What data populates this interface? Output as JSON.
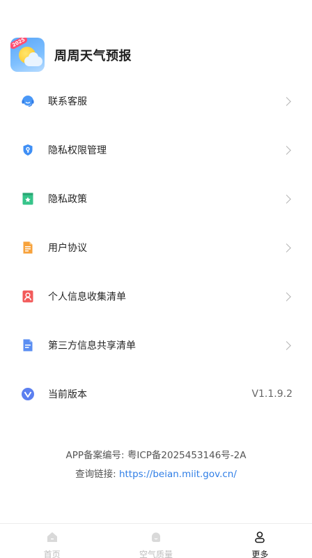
{
  "app": {
    "title": "周周天气预报",
    "logo_badge": "2025"
  },
  "menu": [
    {
      "label": "联系客服",
      "icon": "headset-icon"
    },
    {
      "label": "隐私权限管理",
      "icon": "shield-key-icon"
    },
    {
      "label": "隐私政策",
      "icon": "bookmark-star-icon"
    },
    {
      "label": "用户协议",
      "icon": "document-icon"
    },
    {
      "label": "个人信息收集清单",
      "icon": "user-card-icon"
    },
    {
      "label": "第三方信息共享清单",
      "icon": "file-list-icon"
    },
    {
      "label": "当前版本",
      "icon": "version-v-icon",
      "value": "V1.1.9.2"
    }
  ],
  "footer": {
    "record_label": "APP备案编号:",
    "record_number": "粤ICP备2025453146号-2A",
    "query_label": "查询链接:",
    "query_link": "https://beian.miit.gov.cn/"
  },
  "tabbar": [
    {
      "label": "首页",
      "icon": "home-icon",
      "active": false
    },
    {
      "label": "空气质量",
      "icon": "air-quality-icon",
      "active": false
    },
    {
      "label": "更多",
      "icon": "profile-icon",
      "active": true
    }
  ],
  "colors": {
    "link": "#2f7ee6",
    "accent_blue": "#3f8ff5",
    "chevron": "#b5b5b5"
  }
}
